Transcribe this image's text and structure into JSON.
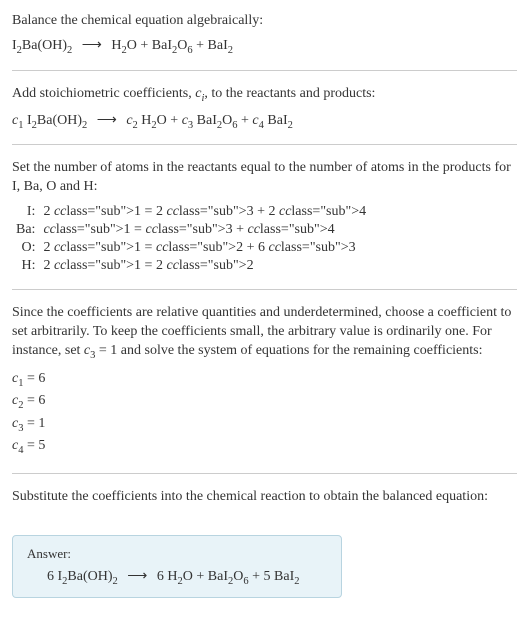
{
  "s1": {
    "intro": "Balance the chemical equation algebraically:"
  },
  "s2": {
    "intro": "Add stoichiometric coefficients, ",
    "intro2": ", to the reactants and products:"
  },
  "s3": {
    "intro": "Set the number of atoms in the reactants equal to the number of atoms in the products for I, Ba, O and H:",
    "rows": [
      {
        "el": "I:",
        "lhs": "2 c",
        "lhs_i": "1",
        "rhs": " = 2 c",
        "rhs_i1": "3",
        "plus": " + 2 c",
        "rhs_i2": "4"
      },
      {
        "el": "Ba:",
        "lhs": "c",
        "lhs_i": "1",
        "rhs": " = c",
        "rhs_i1": "3",
        "plus": " + c",
        "rhs_i2": "4"
      },
      {
        "el": "O:",
        "lhs": "2 c",
        "lhs_i": "1",
        "rhs": " = c",
        "rhs_i1": "2",
        "plus": " + 6 c",
        "rhs_i2": "3"
      },
      {
        "el": "H:",
        "lhs": "2 c",
        "lhs_i": "1",
        "rhs": " = 2 c",
        "rhs_i1": "2",
        "plus": "",
        "rhs_i2": ""
      }
    ]
  },
  "s4": {
    "intro": "Since the coefficients are relative quantities and underdetermined, choose a coefficient to set arbitrarily. To keep the coefficients small, the arbitrary value is ordinarily one. For instance, set ",
    "intro2": " = 1 and solve the system of equations for the remaining coefficients:",
    "c1": " = 6",
    "c2": " = 6",
    "c3": " = 1",
    "c4": " = 5"
  },
  "s5": {
    "intro": "Substitute the coefficients into the chemical reaction to obtain the balanced equation:",
    "answer_label": "Answer:"
  },
  "eq": {
    "I2BaOH2": {
      "a": "I",
      "b": "2",
      "c": "Ba(OH)",
      "d": "2"
    },
    "H2O": {
      "a": "H",
      "b": "2",
      "c": "O"
    },
    "BaI2O6": {
      "a": "BaI",
      "b": "2",
      "c": "O",
      "d": "6"
    },
    "BaI2": {
      "a": "BaI",
      "b": "2"
    },
    "arrow": "⟶",
    "plus": " + ",
    "c": "c",
    "c1": "1",
    "c2": "2",
    "c3": "3",
    "c4": "4",
    "ci": "i",
    "six": "6 ",
    "five": "5 "
  }
}
